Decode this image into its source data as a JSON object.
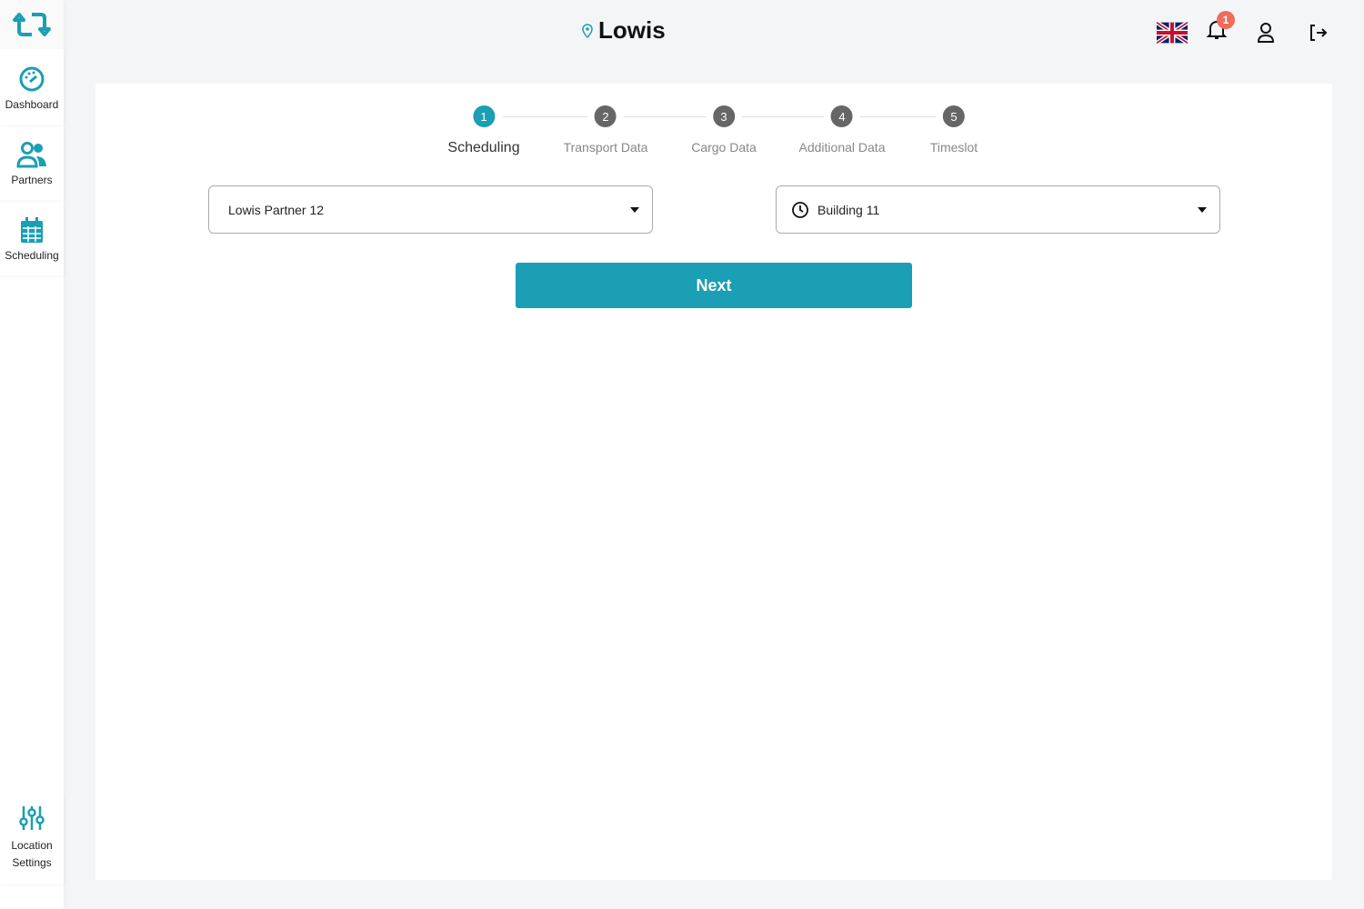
{
  "sidebar": {
    "items": [
      {
        "label": "Dashboard"
      },
      {
        "label": "Partners"
      },
      {
        "label": "Scheduling"
      }
    ],
    "bottom": {
      "label": "Location Settings"
    }
  },
  "header": {
    "title": "Lowis",
    "notification_count": "1"
  },
  "stepper": {
    "steps": [
      {
        "n": "1",
        "label": "Scheduling"
      },
      {
        "n": "2",
        "label": "Transport Data"
      },
      {
        "n": "3",
        "label": "Cargo Data"
      },
      {
        "n": "4",
        "label": "Additional Data"
      },
      {
        "n": "5",
        "label": "Timeslot"
      }
    ],
    "active": 1
  },
  "form": {
    "partner": "Lowis Partner 12",
    "location": "Building 11",
    "next_label": "Next"
  },
  "colors": {
    "accent": "#1a9fb4",
    "badge": "#ef6b5b"
  }
}
